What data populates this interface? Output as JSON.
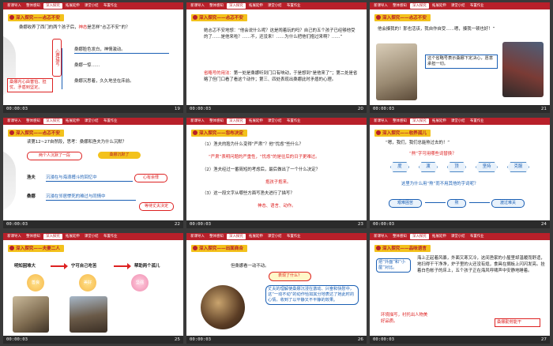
{
  "nav_tabs": [
    "新课导入",
    "整体感知",
    "深入探究",
    "拓展延伸",
    "课堂小结",
    "布置作业"
  ],
  "colors": {
    "topbar": "#b8202a",
    "section_badge": "#f3c21c",
    "accent_red": "#dd2222",
    "accent_blue": "#1a5fb4"
  },
  "slides": [
    {
      "page": "19",
      "time": "00:00:03",
      "active_tab": 2,
      "section": "深入探究——忐忑不安",
      "lines": [
        "桑娜收养了西门的两个孩子后，",
        "是怎样“忐忑不安”的？"
      ],
      "highlight": "神态",
      "vertical": "心理描写",
      "items": [
        "桑娜脸色发白，神情激动。",
        "桑娜一惊……",
        "桑娜沉思着，久久地坐在床前。"
      ],
      "note": "桑娜内心由害怕、担忧、矛盾到坚定。"
    },
    {
      "page": "20",
      "time": "00:00:03",
      "active_tab": 2,
      "section": "深入探究——忐忑不安",
      "lines": [
        "她忐忑不安地想：“他会说什么呢？这是闹着玩的吗？自己的五个孩子已经够他受的了……是他来啦？……不，还没来！……为什么把他们抱过来啊？……”"
      ],
      "red_lines": [
        "省略号的用法：",
        "第一处是桑娜听到门口有响动，于是想到“是他来了”；第二处是省略了但门口看了看这个动作；第三、四处表现出桑娜此时矛盾的心理。"
      ]
    },
    {
      "page": "21",
      "time": "00:00:03",
      "active_tab": 2,
      "section": "深入探究——忐忑不安",
      "lines": [
        "他会揍我的！那也活该，我自作自受……嗯，揍我一顿也好！”"
      ],
      "note": "这个省略号表示桑娜下定决心，愿意承担一切。"
    },
    {
      "page": "22",
      "time": "00:00:03",
      "active_tab": 2,
      "section": "深入探究——忐忑不安",
      "lines": [
        "读第12~27自然段，思考：桑娜和渔夫为什么沉默？"
      ],
      "pills": [
        "两个人沉默了一段",
        "桑娜沉默了"
      ],
      "rows": [
        {
          "who": "渔夫",
          "text": "沉浸在与海浪搏斗的回忆中",
          "tag": "心有余悸"
        },
        {
          "who": "桑娜",
          "text": "沉浸在邻居惨死的难过与同情中",
          "tag": "等待丈夫决定"
        }
      ]
    },
    {
      "page": "23",
      "time": "00:00:03",
      "active_tab": 2,
      "section": "深入探究——忽布决定",
      "lines": [
        "（1）渔夫的脸为什么变得“严肃”？他“忧虑”些什么？",
        "“严肃”表明问题的严重性，“忧虑”的是往后的日子更难过。",
        "（2）渔夫经过一番简短的考虑后，最后做出了一个什么决定？",
        "（3）这一段文字从哪些方面写渔夫进行了描写？"
      ],
      "answers": [
        "抱孩子抱来。",
        "神态、语言、动作。"
      ]
    },
    {
      "page": "24",
      "time": "00:00:03",
      "active_tab": 2,
      "section": "深入探究——收养孤儿",
      "lines": [
        "“嗯，我们，我们总能熬过去的！”",
        "“熬”字可用哪些词替换？",
        "这里为什么用“熬”而不用其他的字词呢？"
      ],
      "hexes": [
        "度",
        "渡",
        "顶",
        "坚持",
        "克服"
      ],
      "bottom": [
        "艰难困苦",
        "熬",
        "渡过难关"
      ]
    },
    {
      "page": "25",
      "time": "00:00:03",
      "active_tab": 2,
      "section": "深入探究——夫妻二人",
      "chain": [
        "明知困难大",
        "宁可自己吃苦",
        "帮助两个孤儿"
      ],
      "flowers": [
        "善良",
        "美好",
        "坚强"
      ]
    },
    {
      "page": "26",
      "time": "00:00:03",
      "active_tab": 2,
      "section": "深入探究——出面商合",
      "lines": [
        "但桑娜看一动不动。"
      ],
      "bubble": "表现了什么？",
      "answer": "丈夫的理解使桑娜沉浸在激动、兴奋和快慰中，这“一动不动”的动作恰如其分地表达了她此时的心情，收到了以平静又不平静的效果。"
    },
    {
      "page": "27",
      "time": "00:00:03",
      "active_tab": 2,
      "section": "深入探究——品味语言",
      "lines": [
        "海上正起着风暴，外面又寒又冷，这间渔家的小屋里却温暖而舒适，地扫得干干净净，炉子里的火还没有熄，食具在搁板上闪闪发亮。挂着白色帐子的床上，五个孩子正在海风呼啸声中安静地睡着。"
      ],
      "left_box": "把“外面”和“小屋”对比。",
      "bottom_left": "环境描写，衬托出人物美好品质。",
      "bottom_right": "桑娜勤劳能干"
    }
  ]
}
